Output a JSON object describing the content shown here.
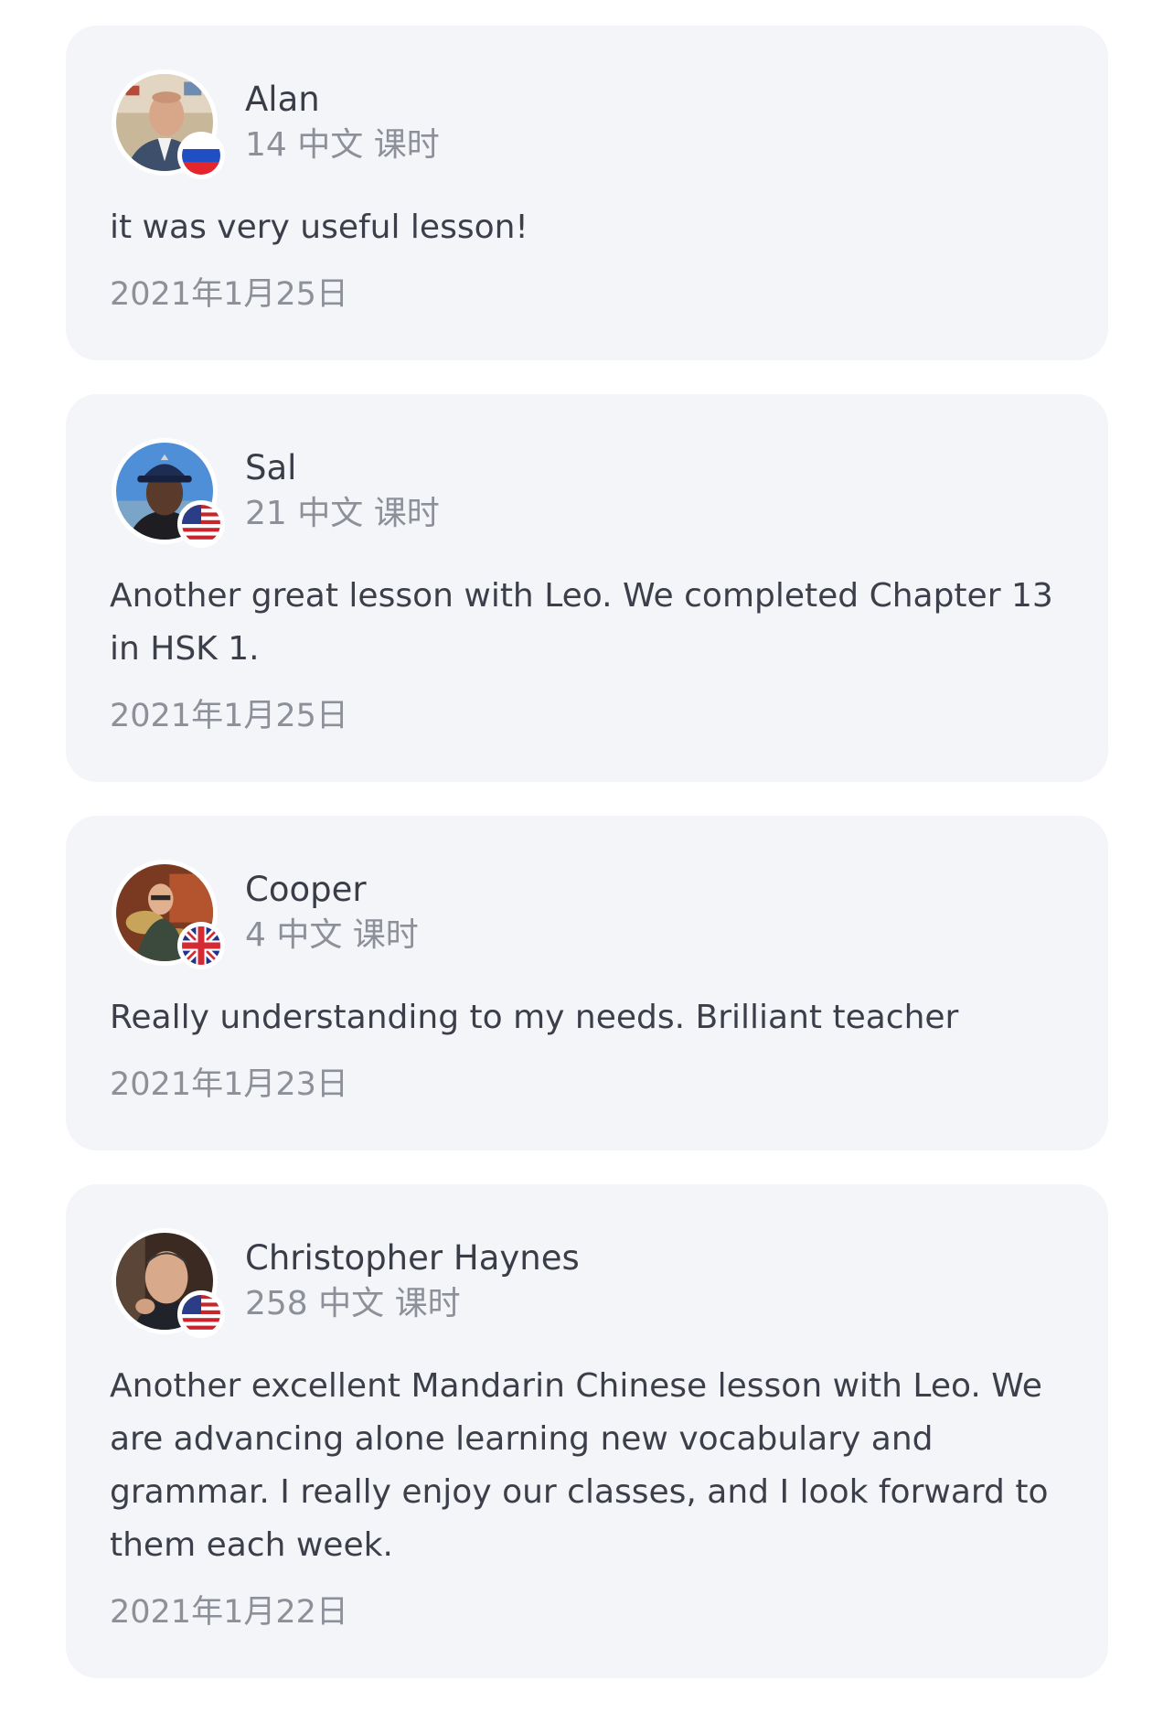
{
  "reviews": [
    {
      "name": "Alan",
      "lessons": "14 中文 课时",
      "flag": "russia-flag-icon",
      "text": "it was very useful lesson!",
      "date": "2021年1月25日"
    },
    {
      "name": "Sal",
      "lessons": "21 中文 课时",
      "flag": "usa-flag-icon",
      "text": "Another great lesson with Leo. We completed Chapter 13 in HSK 1.",
      "date": "2021年1月25日"
    },
    {
      "name": "Cooper",
      "lessons": "4 中文 课时",
      "flag": "uk-flag-icon",
      "text": "Really understanding to my needs. Brilliant teacher",
      "date": "2021年1月23日"
    },
    {
      "name": "Christopher Haynes",
      "lessons": "258 中文 课时",
      "flag": "usa-flag-icon",
      "text": "Another excellent Mandarin Chinese lesson with Leo. We are advancing alone learning new vocabulary and grammar. I really enjoy our classes, and I look forward to them each week.",
      "date": "2021年1月22日"
    }
  ],
  "colors": {
    "card_background": "#f4f5f9",
    "primary_text": "#3c3f4a",
    "secondary_text": "#8d8f99"
  }
}
